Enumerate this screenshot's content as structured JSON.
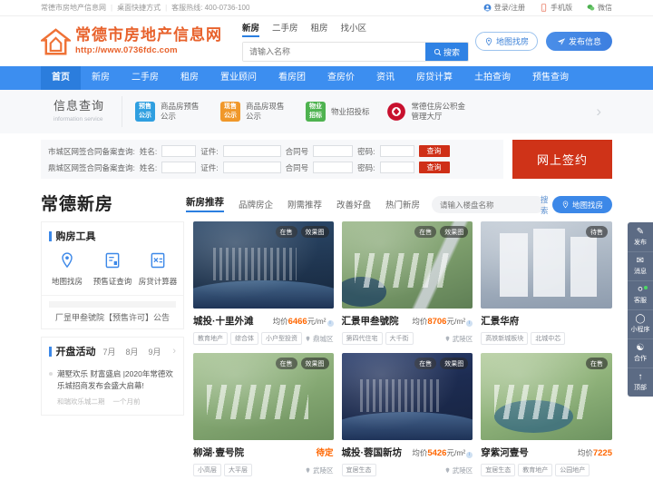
{
  "topbar": {
    "site_name": "常德市房地产信息网",
    "shortcut": "桌面快捷方式",
    "hotline": "客服热线: 400-0736-100",
    "sep": "|",
    "login": "登录/注册",
    "mobile": "手机版",
    "wechat": "微信"
  },
  "header": {
    "logo_title": "常德市房地产信息网",
    "logo_url": "http://www.0736fdc.com",
    "search_tabs": [
      {
        "label": "新房",
        "active": true
      },
      {
        "label": "二手房",
        "active": false
      },
      {
        "label": "租房",
        "active": false
      },
      {
        "label": "找小区",
        "active": false
      }
    ],
    "search_placeholder": "请输入名称",
    "search_value": "",
    "search_button": "搜索",
    "map_button": "地图找房",
    "publish_button": "发布信息"
  },
  "nav": {
    "items": [
      {
        "label": "首页",
        "active": true
      },
      {
        "label": "新房",
        "active": false
      },
      {
        "label": "二手房",
        "active": false
      },
      {
        "label": "租房",
        "active": false
      },
      {
        "label": "置业顾问",
        "active": false
      },
      {
        "label": "看房团",
        "active": false
      },
      {
        "label": "查房价",
        "active": false
      },
      {
        "label": "资讯",
        "active": false
      },
      {
        "label": "房贷计算",
        "active": false
      },
      {
        "label": "土拍查询",
        "active": false
      },
      {
        "label": "预售查询",
        "active": false
      }
    ]
  },
  "info_service": {
    "title_cn": "信息查询",
    "title_en": "information service",
    "items": [
      {
        "badge_line1": "预售",
        "badge_line2": "公示",
        "label": "商品房预售公示",
        "color": "#2f9fe0"
      },
      {
        "badge_line1": "现售",
        "badge_line2": "公示",
        "label": "商品房现售公示",
        "color": "#f0982a"
      },
      {
        "badge_line1": "物业",
        "badge_line2": "招标",
        "label": "物业招投标",
        "color": "#4fb350"
      },
      {
        "badge_line1": "",
        "badge_line2": "",
        "label": "常德住房公积金管理大厅",
        "color": "#c8102e"
      }
    ],
    "arrow": "›"
  },
  "queries": {
    "rows": [
      {
        "label": "市城区网签合同备案查询:",
        "name_label": "姓名:",
        "name_value": "",
        "id_label": "证件:",
        "id_value": "",
        "contract_label": "合同号",
        "contract_value": "",
        "password_label": "密码:",
        "password_value": "",
        "button": "查询"
      },
      {
        "label": "鼎城区网签合同备案查询:",
        "name_label": "姓名:",
        "name_value": "",
        "id_label": "证件:",
        "id_value": "",
        "contract_label": "合同号",
        "contract_value": "",
        "password_label": "密码:",
        "password_value": "",
        "button": "查询"
      }
    ],
    "sign_button": "网上签约"
  },
  "section": {
    "title": "常德新房",
    "tabs": [
      {
        "label": "新房推荐",
        "active": true
      },
      {
        "label": "品牌房企",
        "active": false
      },
      {
        "label": "刚需推荐",
        "active": false
      },
      {
        "label": "改善好盘",
        "active": false
      },
      {
        "label": "热门新房",
        "active": false
      }
    ],
    "search_placeholder": "请输入楼盘名称",
    "search_value": "",
    "search_link": "搜索",
    "map_button": "地图找房"
  },
  "tools_panel": {
    "title": "购房工具",
    "tools": [
      {
        "label": "地图找房",
        "icon": "map-pin-icon"
      },
      {
        "label": "预售证查询",
        "icon": "document-icon"
      },
      {
        "label": "房贷计算器",
        "icon": "calculator-icon"
      }
    ],
    "notice": "厂昰甲叁號院【预售许可】公告"
  },
  "opening_panel": {
    "title": "开盘活动",
    "tabs": [
      {
        "label": "7月",
        "active": false
      },
      {
        "label": "8月",
        "active": false
      },
      {
        "label": "9月",
        "active": false
      }
    ],
    "arrow": "›",
    "news_title": "潮墅欢乐 财富盛启 |2020年常德欢乐城招商发布会盛大启幕!",
    "news_source": "和瑞欢乐城二期",
    "news_time": "一个月前"
  },
  "cards": [
    {
      "name": "城投·十里外滩",
      "badges": [
        "在售",
        "效果图"
      ],
      "price_prefix": "均价",
      "price_value": "6466",
      "price_unit": "元/m²",
      "pending": "",
      "tags": [
        "教育地产",
        "综合体",
        "小户型投资"
      ],
      "location": "鼎城区",
      "art": "img-e"
    },
    {
      "name": "汇景甲叁號院",
      "badges": [
        "在售",
        "效果图"
      ],
      "price_prefix": "均价",
      "price_value": "8706",
      "price_unit": "元/m²",
      "pending": "",
      "tags": [
        "第四代住宅",
        "大千街"
      ],
      "location": "武陵区",
      "art": "img-b"
    },
    {
      "name": "汇景华府",
      "badges": [
        "待售"
      ],
      "price_prefix": "",
      "price_value": "",
      "price_unit": "",
      "pending": "",
      "tags": [
        "高铁新城板块",
        "北城中芯"
      ],
      "location": "",
      "art": "img-c"
    },
    {
      "name": "柳湖·壹号院",
      "badges": [
        "在售",
        "效果图"
      ],
      "price_prefix": "",
      "price_value": "",
      "price_unit": "",
      "pending": "待定",
      "tags": [
        "小高层",
        "大平层"
      ],
      "location": "武陵区",
      "art": "img-d"
    },
    {
      "name": "城投·蓉国新坊",
      "badges": [
        "在售",
        "效果图"
      ],
      "price_prefix": "均价",
      "price_value": "5426",
      "price_unit": "元/m²",
      "pending": "",
      "tags": [
        "宜居生态"
      ],
      "location": "武陵区",
      "art": "img-a"
    },
    {
      "name": "穿紫河壹号",
      "badges": [
        "在售"
      ],
      "price_prefix": "均价",
      "price_value": "7225",
      "price_unit": "",
      "pending": "",
      "tags": [
        "宜居生态",
        "教育地产",
        "公园地产"
      ],
      "location": "",
      "art": "img-f"
    }
  ],
  "float_bar": {
    "items": [
      {
        "label": "发布",
        "icon": "pencil-square-icon",
        "dot": false
      },
      {
        "label": "消息",
        "icon": "message-icon",
        "dot": false
      },
      {
        "label": "客服",
        "icon": "headset-icon",
        "dot": true
      },
      {
        "label": "小程序",
        "icon": "miniapp-icon",
        "dot": false
      },
      {
        "label": "合作",
        "icon": "handshake-icon",
        "dot": false
      },
      {
        "label": "顶部",
        "icon": "arrow-up-icon",
        "dot": false
      }
    ]
  },
  "colors": {
    "brand_orange": "#e8622c",
    "nav_blue": "#3c8ef0",
    "accent_red": "#cf3318",
    "price_orange": "#ff6600"
  }
}
